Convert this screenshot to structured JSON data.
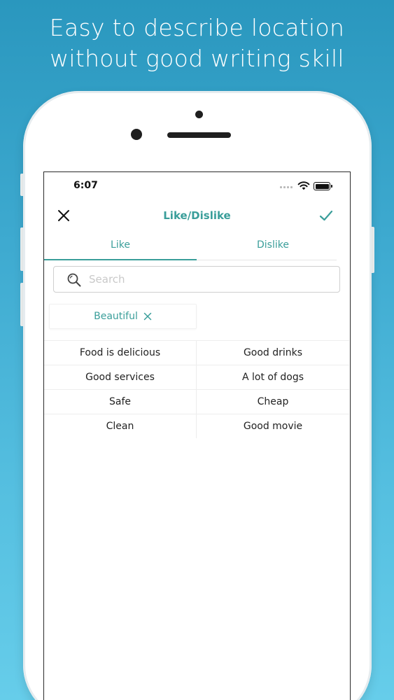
{
  "headline": {
    "line1": "Easy to describe location",
    "line2": "without good writing skill"
  },
  "status_bar": {
    "time": "6:07"
  },
  "nav": {
    "title": "Like/Dislike",
    "accent_color": "#3a9e9a"
  },
  "tabs": [
    {
      "label": "Like",
      "selected": true
    },
    {
      "label": "Dislike",
      "selected": false
    }
  ],
  "search": {
    "placeholder": "Search",
    "value": ""
  },
  "selected_tags": [
    {
      "label": "Beautiful"
    }
  ],
  "options": [
    [
      "Food is delicious",
      "Good drinks"
    ],
    [
      "Good services",
      "A lot of dogs"
    ],
    [
      "Safe",
      "Cheap"
    ],
    [
      "Clean",
      "Good movie"
    ]
  ],
  "icons": {
    "close": "close-icon",
    "confirm": "checkmark-icon",
    "search": "search-icon",
    "chip_remove": "close-icon",
    "wifi": "wifi-icon",
    "battery": "battery-icon"
  }
}
